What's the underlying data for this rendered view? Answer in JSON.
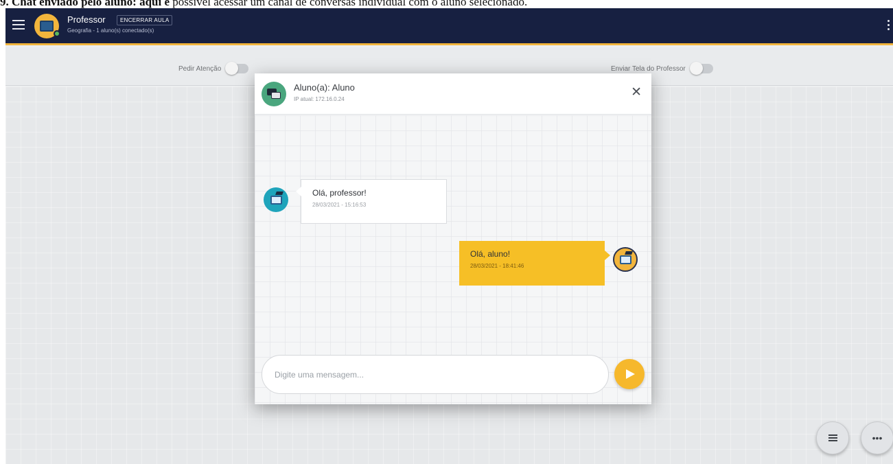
{
  "caption": {
    "bold": "9. Chat enviado pelo aluno:",
    "bold_parts": [
      "aqui é"
    ],
    "text": " possível acessar um canal de conversas individual com o aluno selecionado."
  },
  "topbar": {
    "title": "Professor",
    "end_class_label": "ENCERRAR AULA",
    "subtitle": "Geografia - 1 aluno(s) conectado(s)"
  },
  "toggles": {
    "ask_attention_label": "Pedir Atenção",
    "send_screen_label": "Enviar Tela do Professor"
  },
  "chat_modal": {
    "title": "Aluno(a): Aluno",
    "ip": "IP atual: 172.16.0.24",
    "messages": [
      {
        "text": "Olá, professor!",
        "time": "28/03/2021 - 15:16:53"
      },
      {
        "text": "Olá, aluno!",
        "time": "28/03/2021 - 18:41:46"
      }
    ],
    "input_placeholder": "Digite uma mensagem..."
  },
  "colors": {
    "topbar_bg": "#172041",
    "accent": "#f2b53c",
    "student_avatar": "#1fa4bb",
    "reply_bubble": "#f6bf26"
  }
}
